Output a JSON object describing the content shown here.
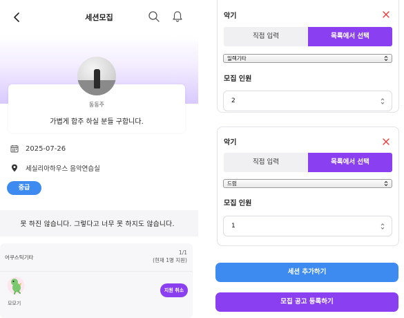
{
  "header": {
    "title": "세션모집",
    "back_icon": "back-arrow-icon",
    "search_icon": "search-icon",
    "bell_icon": "bell-icon"
  },
  "profile": {
    "host_name": "동동주",
    "intro": "가볍게 합주 하실 분들 구합니다."
  },
  "details": {
    "date": "2025-07-26",
    "location": "세실리아하우스 음악연습실",
    "level": "중급"
  },
  "description": "못 하진 않습니다. 그렇다고 너무 못 하지도 않습니다.",
  "position": {
    "instrument": "어쿠스틱기타",
    "count": "1/1",
    "applicants": "(현재 1명 지원)",
    "member_name": "모모기",
    "cancel_label": "지원 취소"
  },
  "instrument_cards": [
    {
      "label": "악기",
      "mode_options": [
        "직접 입력",
        "목록에서 선택"
      ],
      "selected_mode": "목록에서 선택",
      "selected_instrument": "일렉기타",
      "recruit_label": "모집 인원",
      "recruit_count": "2"
    },
    {
      "label": "악기",
      "mode_options": [
        "직접 입력",
        "목록에서 선택"
      ],
      "selected_mode": "목록에서 선택",
      "selected_instrument": "드럼",
      "recruit_label": "모집 인원",
      "recruit_count": "1"
    }
  ],
  "actions": {
    "add_session": "세션 추가하기",
    "register": "모집 공고 등록하기"
  },
  "colors": {
    "accent_purple": "#8a3ff0",
    "accent_blue": "#3d8bf0",
    "close_red": "#e53935"
  }
}
